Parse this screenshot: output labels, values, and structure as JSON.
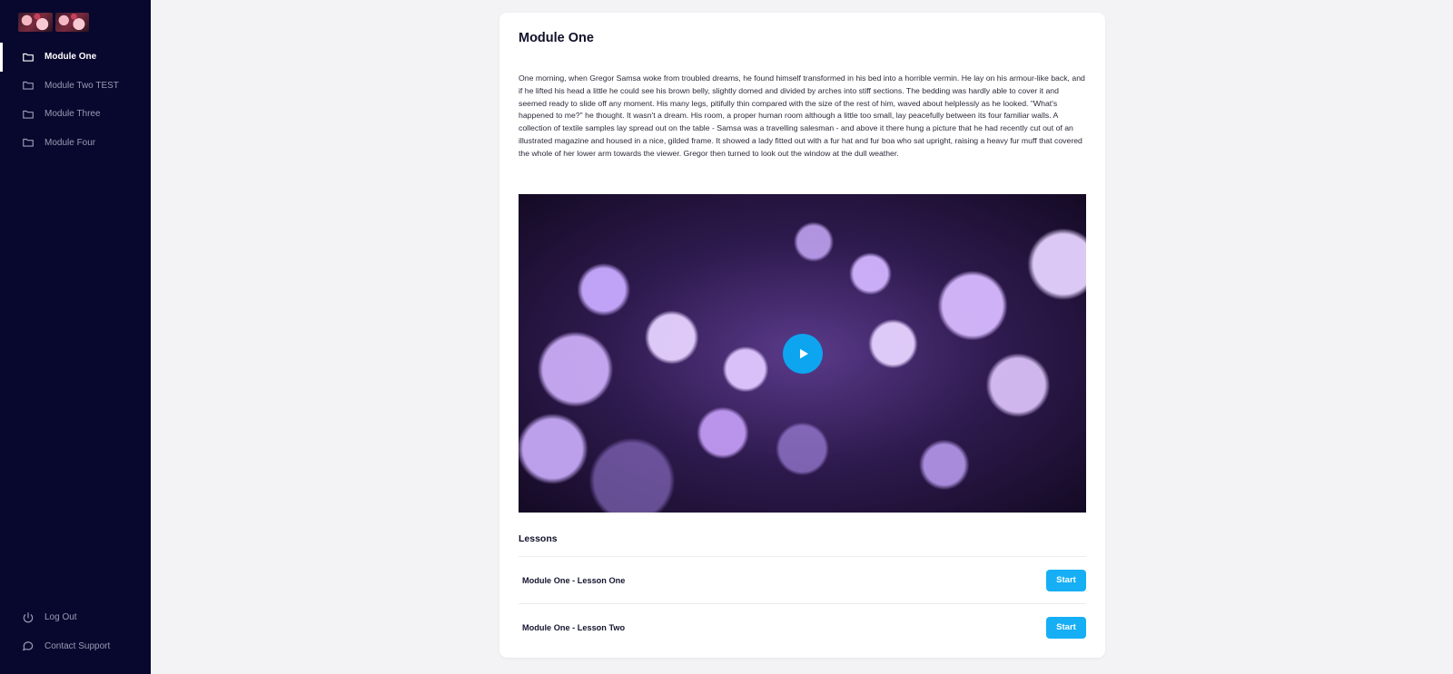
{
  "sidebar": {
    "logo_alt": "flower logo",
    "items": [
      {
        "label": "Module One",
        "icon": "folder-icon",
        "active": true
      },
      {
        "label": "Module Two TEST",
        "icon": "folder-icon",
        "active": false
      },
      {
        "label": "Module Three",
        "icon": "folder-icon",
        "active": false
      },
      {
        "label": "Module Four",
        "icon": "folder-icon",
        "active": false
      }
    ],
    "bottom": [
      {
        "label": "Log Out",
        "icon": "power-icon"
      },
      {
        "label": "Contact Support",
        "icon": "chat-icon"
      }
    ]
  },
  "main": {
    "title": "Module One",
    "description": "One morning, when Gregor Samsa woke from troubled dreams, he found himself transformed in his bed into a horrible vermin. He lay on his armour-like back, and if he lifted his head a little he could see his brown belly, slightly domed and divided by arches into stiff sections. The bedding was hardly able to cover it and seemed ready to slide off any moment. His many legs, pitifully thin compared with the size of the rest of him, waved about helplessly as he looked. \"What's happened to me?\" he thought. It wasn't a dream. His room, a proper human room although a little too small, lay peacefully between its four familiar walls. A collection of textile samples lay spread out on the table - Samsa was a travelling salesman - and above it there hung a picture that  he had recently cut out of an illustrated magazine and housed in a nice, gilded frame. It showed a lady fitted out with a fur hat and fur boa who sat upright, raising a heavy fur muff that covered the whole of her lower arm towards the viewer. Gregor then turned to look out the window at the dull weather.",
    "video": {
      "play_icon": "play-icon"
    },
    "lessons_title": "Lessons",
    "lessons": [
      {
        "name": "Module One - Lesson One",
        "button": "Start"
      },
      {
        "name": "Module One - Lesson Two",
        "button": "Start"
      }
    ]
  },
  "colors": {
    "sidebar_bg": "#08082e",
    "accent": "#16aef5",
    "page_bg": "#f3f3f6"
  }
}
